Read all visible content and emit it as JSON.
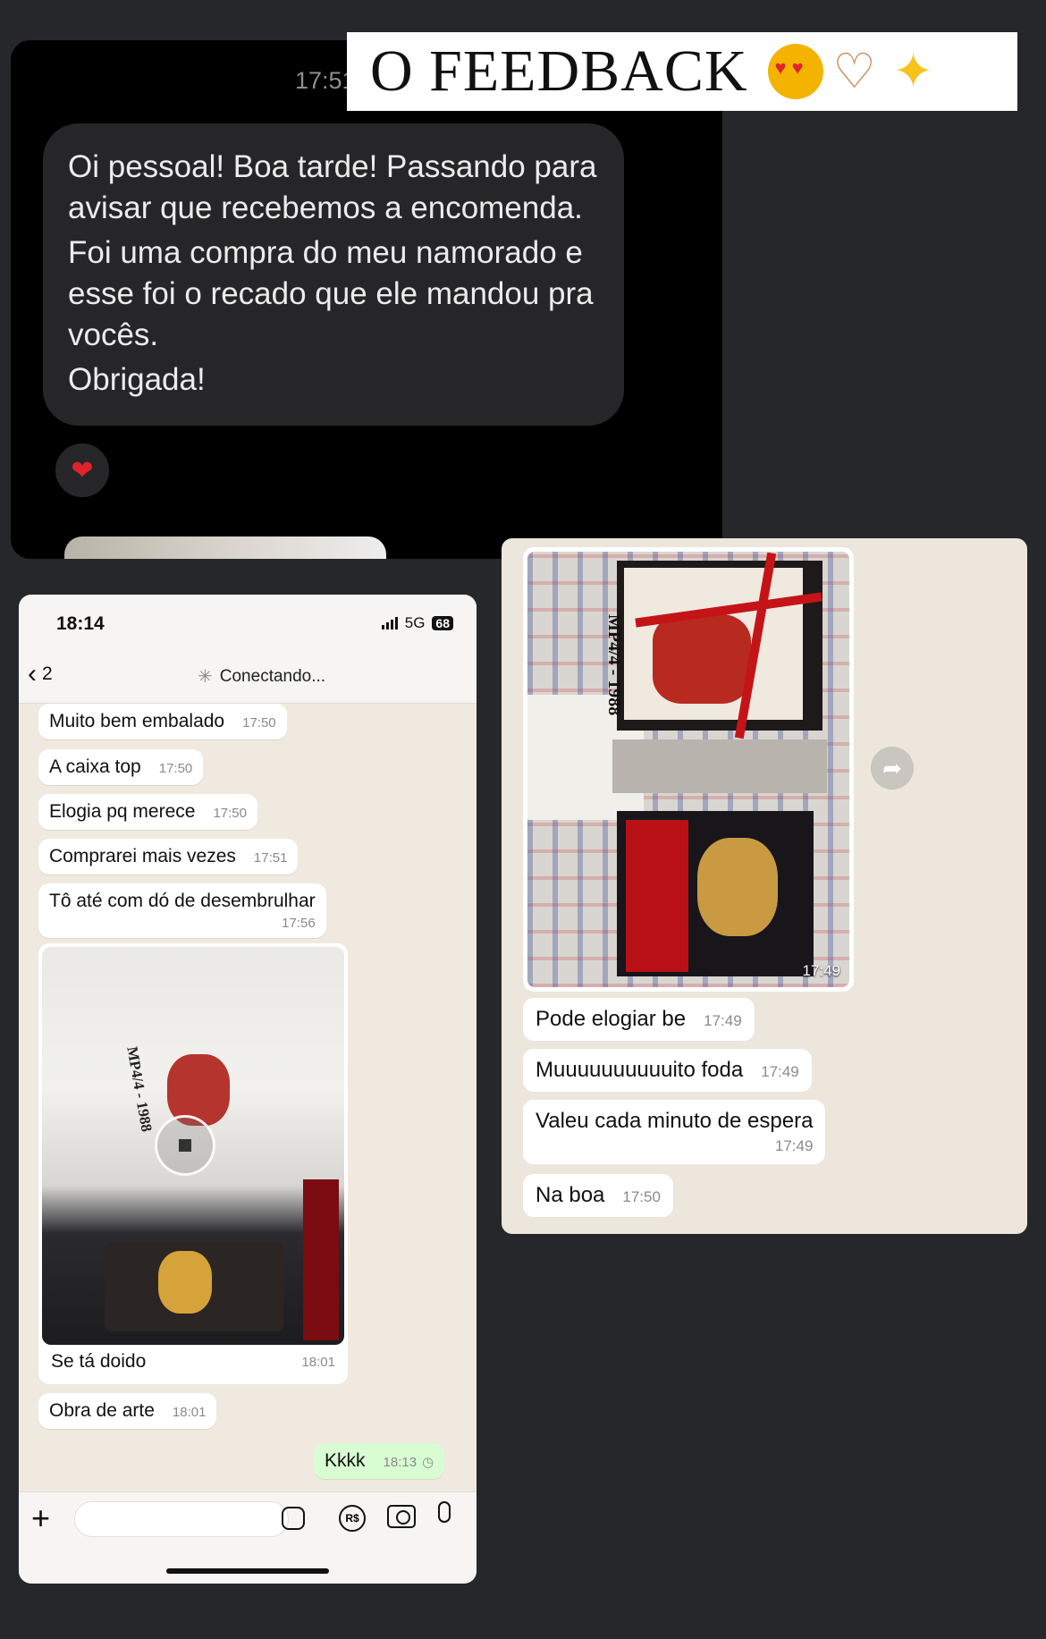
{
  "banner": {
    "title": "O FEEDBACK",
    "emojis": [
      "smiling-cat-heart-eyes-emoji",
      "heart-hands-emoji",
      "sparkles-emoji"
    ]
  },
  "top_chat": {
    "time": "17:51",
    "message_paragraphs": [
      "Oi pessoal! Boa tarde! Passando para avisar que recebemos a encomenda.",
      "Foi uma compra do meu namorado e esse foi o recado que ele mandou pra vocês.",
      "Obrigada!"
    ],
    "reaction": "❤",
    "reaction_icon": "red-heart-icon"
  },
  "left_phone": {
    "status": {
      "time": "18:14",
      "network": "5G",
      "battery": "68"
    },
    "nav": {
      "back_count": "2",
      "status_text": "Conectando..."
    },
    "messages": [
      {
        "text": "Muito bem embalado",
        "time": "17:50"
      },
      {
        "text": "A caixa top",
        "time": "17:50"
      },
      {
        "text": "Elogia pq merece",
        "time": "17:50"
      },
      {
        "text": "Comprarei mais vezes",
        "time": "17:51"
      },
      {
        "text": "Tô até com dó de desembrulhar",
        "time": "17:56"
      }
    ],
    "image_message": {
      "caption": "Se tá doido",
      "time": "18:01",
      "shirt_text": "MP4/4 - 1988"
    },
    "after_image": {
      "text": "Obra de arte",
      "time": "18:01"
    },
    "outgoing": {
      "text": "Kkkk",
      "time": "18:13"
    },
    "composer": {
      "money_icon_text": "R$"
    }
  },
  "right_chat": {
    "image": {
      "time": "17:49",
      "box_label": "MP4/4 - 1988"
    },
    "messages": [
      {
        "text": "Pode elogiar be",
        "time": "17:49"
      },
      {
        "text": "Muuuuuuuuuuito foda",
        "time": "17:49"
      },
      {
        "text": "Valeu cada minuto de espera",
        "time": "17:49"
      },
      {
        "text": "Na boa",
        "time": "17:50"
      }
    ]
  },
  "colors": {
    "outgoing_bubble": "#d9fdd3",
    "chat_bg": "#efe9df",
    "dark_bubble": "#262628",
    "heart": "#e0232b"
  }
}
